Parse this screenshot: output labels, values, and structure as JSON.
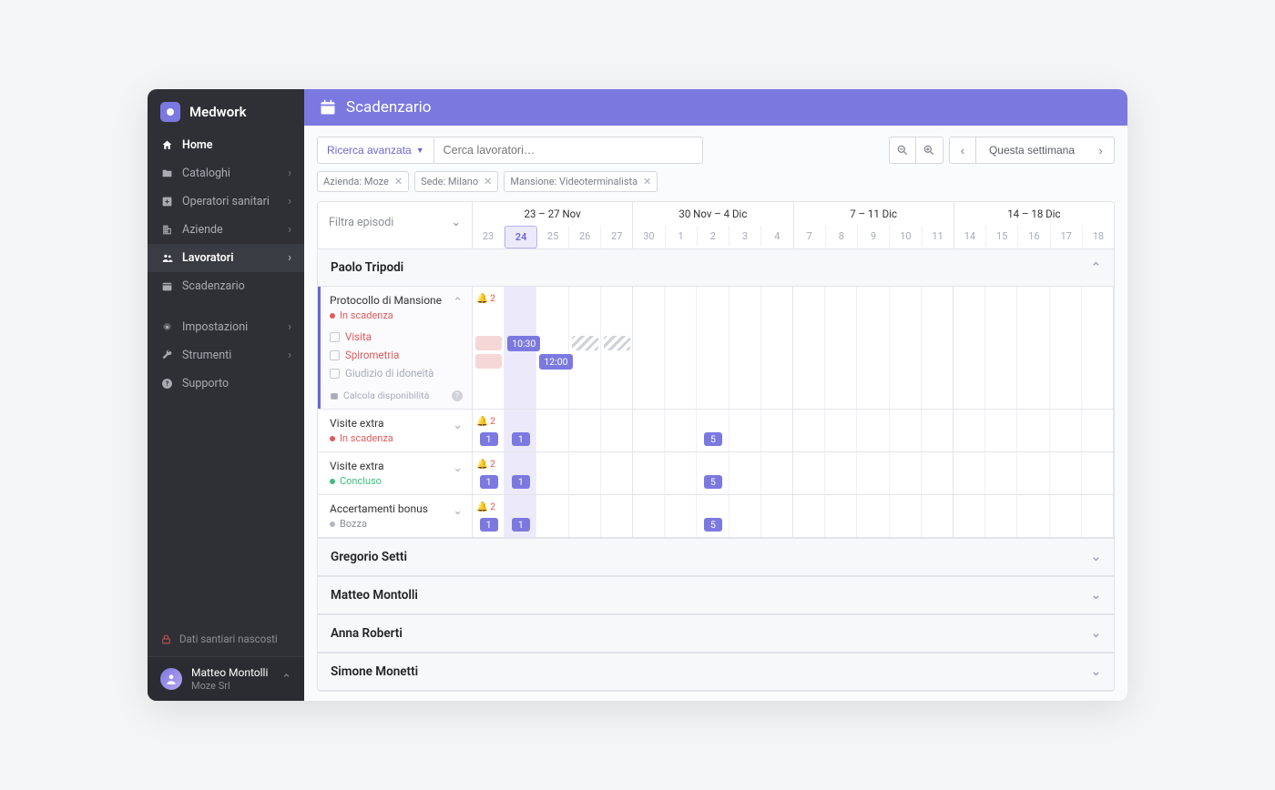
{
  "brand": "Medwork",
  "nav": {
    "home": "Home",
    "cataloghi": "Cataloghi",
    "operatori": "Operatori sanitari",
    "aziende": "Aziende",
    "lavoratori": "Lavoratori",
    "scadenzario": "Scadenzario",
    "impostazioni": "Impostazioni",
    "strumenti": "Strumenti",
    "supporto": "Supporto"
  },
  "sidebarFooter": {
    "lockText": "Dati santiari nascosti",
    "userName": "Matteo Montolli",
    "userOrg": "Moze Srl"
  },
  "header": {
    "title": "Scadenzario"
  },
  "toolbar": {
    "advSearch": "Ricerca avanzata",
    "searchPlaceholder": "Cerca lavoratori…",
    "thisWeek": "Questa settimana"
  },
  "chips": [
    {
      "label": "Azienda: Moze"
    },
    {
      "label": "Sede: Milano"
    },
    {
      "label": "Mansione: Videoterminalista"
    }
  ],
  "filterEpisodes": "Filtra episodi",
  "weeks": [
    {
      "label": "23 – 27 Nov",
      "days": [
        "23",
        "24",
        "25",
        "26",
        "27"
      ]
    },
    {
      "label": "30 Nov – 4 Dic",
      "days": [
        "30",
        "1",
        "2",
        "3",
        "4"
      ]
    },
    {
      "label": "7 – 11 Dic",
      "days": [
        "7",
        "8",
        "9",
        "10",
        "11"
      ]
    },
    {
      "label": "14 – 18 Dic",
      "days": [
        "14",
        "15",
        "16",
        "17",
        "18"
      ]
    }
  ],
  "people": {
    "p0": "Paolo Tripodi",
    "p1": "Gregorio Setti",
    "p2": "Matteo Montolli",
    "p3": "Anna Roberti",
    "p4": "Simone Monetti"
  },
  "episodes": {
    "e0": {
      "title": "Protocollo di Mansione",
      "status": "In scadenza",
      "bell": "2"
    },
    "e1": {
      "title": "Visite extra",
      "status": "In scadenza",
      "bell": "2"
    },
    "e2": {
      "title": "Visite extra",
      "status": "Concluso",
      "bell": "2"
    },
    "e3": {
      "title": "Accertamenti bonus",
      "status": "Bozza",
      "bell": "2"
    }
  },
  "subtasks": {
    "visita": "Visita",
    "spiro": "Spirometria",
    "giudizio": "Giudizio di idoneità",
    "calc": "Calcola disponibilità"
  },
  "pills": {
    "t1030": "10:30",
    "t1200": "12:00",
    "n1": "1",
    "n5": "5"
  }
}
